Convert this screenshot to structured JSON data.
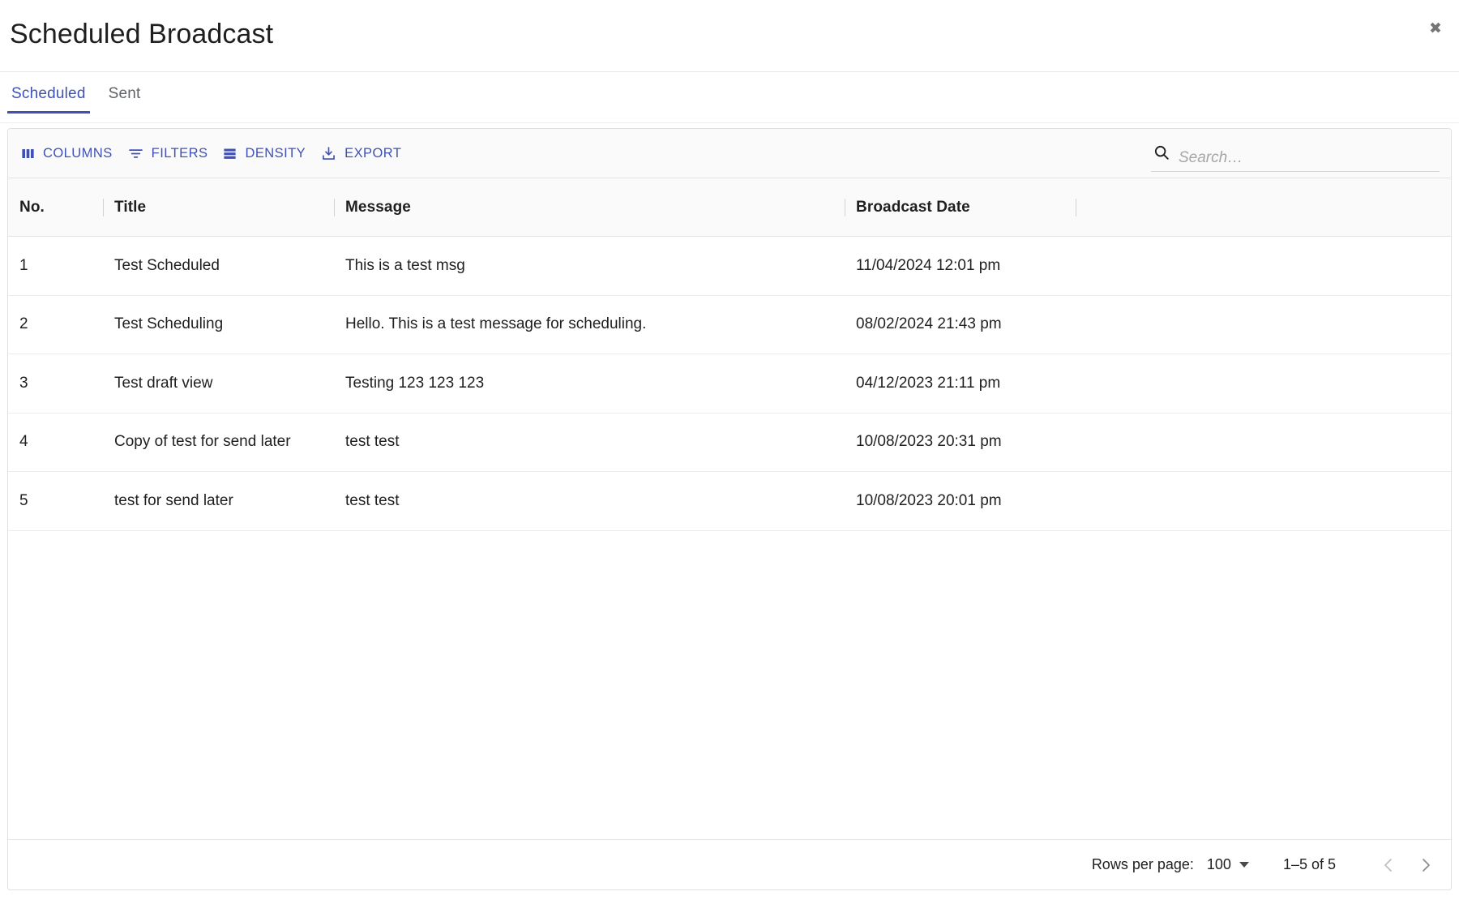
{
  "dialog": {
    "title": "Scheduled Broadcast",
    "close_label": "✖"
  },
  "tabs": [
    {
      "label": "Scheduled",
      "active": true
    },
    {
      "label": "Sent",
      "active": false
    }
  ],
  "toolbar": {
    "columns_label": "COLUMNS",
    "filters_label": "FILTERS",
    "density_label": "DENSITY",
    "export_label": "EXPORT",
    "search_placeholder": "Search…",
    "search_value": ""
  },
  "table": {
    "columns": [
      "No.",
      "Title",
      "Message",
      "Broadcast Date",
      ""
    ],
    "rows": [
      {
        "no": "1",
        "title": "Test Scheduled",
        "message": "This is a test msg",
        "date": "11/04/2024 12:01 pm"
      },
      {
        "no": "2",
        "title": "Test Scheduling",
        "message": "Hello. This is a test message for scheduling.",
        "date": "08/02/2024 21:43 pm"
      },
      {
        "no": "3",
        "title": "Test draft view",
        "message": "Testing 123 123 123",
        "date": "04/12/2023 21:11 pm"
      },
      {
        "no": "4",
        "title": "Copy of test for send later",
        "message": "test test",
        "date": "10/08/2023 20:31 pm"
      },
      {
        "no": "5",
        "title": "test for send later",
        "message": "test test",
        "date": "10/08/2023 20:01 pm"
      }
    ]
  },
  "footer": {
    "rows_per_page_label": "Rows per page:",
    "rows_per_page_value": "100",
    "range_label": "1–5 of 5",
    "prev_label": "‹",
    "next_label": "›"
  },
  "colors": {
    "accent": "#3f51b5",
    "text": "#1f1f1f",
    "muted": "#5f6368",
    "border": "#e0e0e0",
    "toolbar_bg": "#fafafa"
  }
}
